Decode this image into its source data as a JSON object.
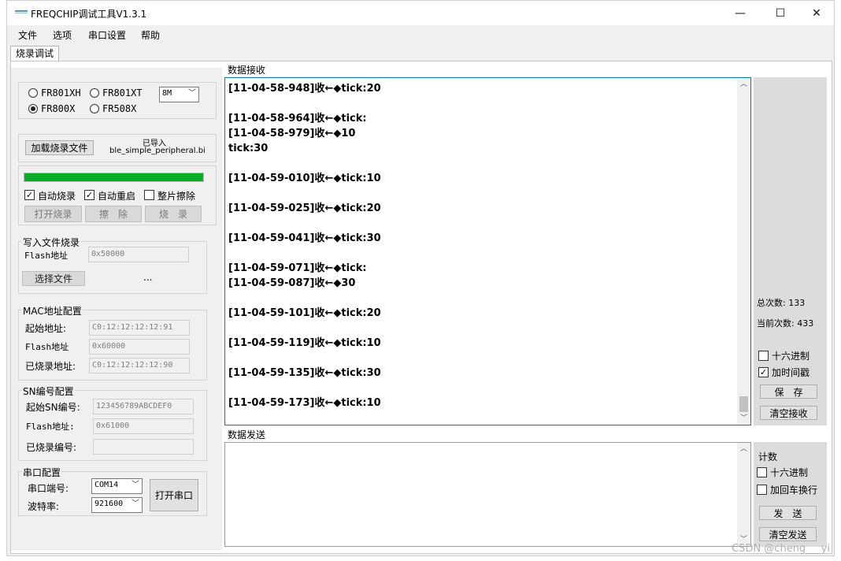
{
  "window": {
    "title": "FREQCHIP调试工具V1.3.1",
    "controls": {
      "minimize": "—",
      "maximize": "☐",
      "close": "✕"
    }
  },
  "menu": [
    "文件",
    "选项",
    "串口设置",
    "帮助"
  ],
  "tabs": [
    "烧录调试"
  ],
  "chip": {
    "options": [
      "FR801XH",
      "FR801XT",
      "FR800X",
      "FR508X"
    ],
    "selected": "FR800X",
    "size": "8M"
  },
  "load": {
    "button": "加载烧录文件",
    "status": "已导入",
    "filename": "ble_simple_peripheral.bi"
  },
  "burn": {
    "progress": 1.0,
    "progress_color": "#06b025",
    "auto_burn": "自动烧录",
    "auto_restart": "自动重启",
    "full_erase": "整片擦除",
    "open_button": "打开烧录",
    "erase_button": "擦　除",
    "burn_button": "烧　录"
  },
  "write_file": {
    "title": "写入文件烧录",
    "flash_label": "Flash地址",
    "flash_value": "0x50000",
    "select_button": "选择文件",
    "file_placeholder": "..."
  },
  "mac": {
    "title": "MAC地址配置",
    "start_label": "起始地址:",
    "start_value": "C0:12:12:12:12:91",
    "flash_label": "Flash地址",
    "flash_value": "0x60000",
    "burned_label": "已烧录地址:",
    "burned_value": "C0:12:12:12:12:90"
  },
  "sn": {
    "title": "SN编号配置",
    "start_label": "起始SN编号:",
    "start_value": "123456789ABCDEF0",
    "flash_label": "Flash地址:",
    "flash_value": "0x61000",
    "burned_label": "已烧录编号:",
    "burned_value": ""
  },
  "serial": {
    "title": "串口配置",
    "port_label": "串口端号:",
    "port_value": "COM14",
    "baud_label": "波特率:",
    "baud_value": "921600",
    "open_button": "打开串口"
  },
  "receive": {
    "title": "数据接收",
    "lines": [
      "[11-04-58-948]收←◆tick:20",
      "",
      "[11-04-58-964]收←◆tick:",
      "[11-04-58-979]收←◆10",
      "tick:30",
      "",
      "[11-04-59-010]收←◆tick:10",
      "",
      "[11-04-59-025]收←◆tick:20",
      "",
      "[11-04-59-041]收←◆tick:30",
      "",
      "[11-04-59-071]收←◆tick:",
      "[11-04-59-087]收←◆30",
      "",
      "[11-04-59-101]收←◆tick:20",
      "",
      "[11-04-59-119]收←◆tick:10",
      "",
      "[11-04-59-135]收←◆tick:30",
      "",
      "[11-04-59-173]收←◆tick:10"
    ],
    "total_count": "总次数: 133",
    "current_count": "当前次数: 433",
    "hex": "十六进制",
    "timestamp": "加时间戳",
    "save_button": "保　存",
    "clear_button": "清空接收"
  },
  "send": {
    "title": "数据发送",
    "content": "",
    "count_label": "计数",
    "hex": "十六进制",
    "crlf": "加回车换行",
    "send_button": "发　送",
    "clear_button": "清空发送"
  },
  "watermark": "CSDN @cheng___yi"
}
